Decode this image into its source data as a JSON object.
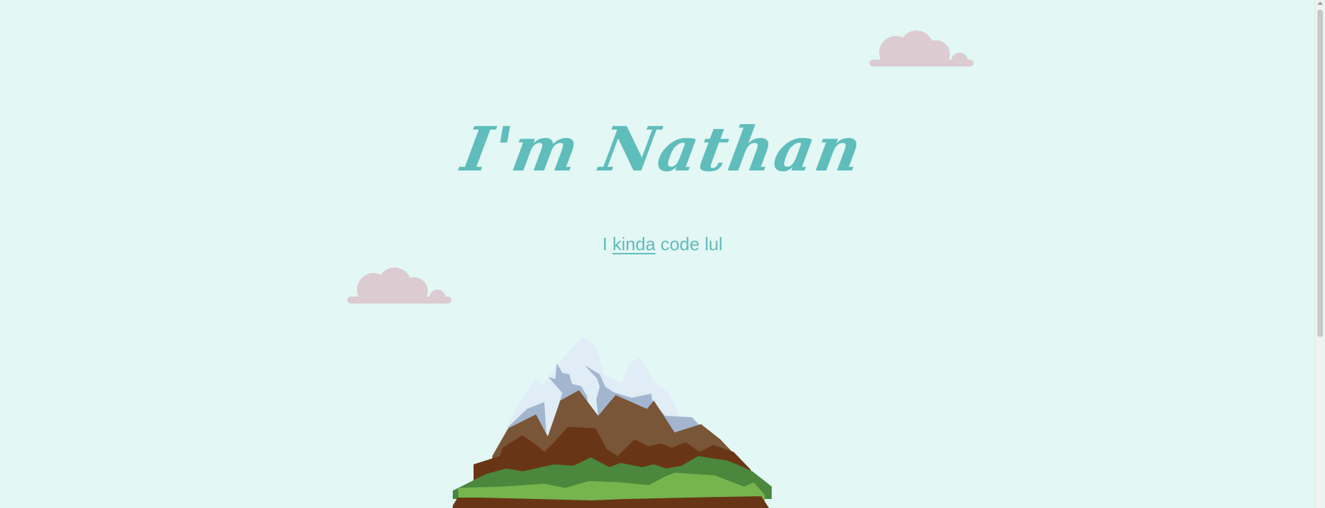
{
  "hero": {
    "title": "I'm Nathan",
    "subtitle_before": "I ",
    "subtitle_link": "kinda",
    "subtitle_after": " code lul"
  },
  "colors": {
    "background": "#e3f7f4",
    "accent": "#5fbdbb",
    "cloud": "#dccbd1",
    "snow": "#e0ecf6",
    "snow_shadow": "#a3b6cf",
    "rock": "#7a5638",
    "rock_dark": "#683616",
    "grass_dark": "#4b873c",
    "grass_light": "#76b44e"
  },
  "icons": {
    "cloud_top": "cloud-icon",
    "cloud_mid": "cloud-icon",
    "mountain": "mountain-illustration"
  }
}
